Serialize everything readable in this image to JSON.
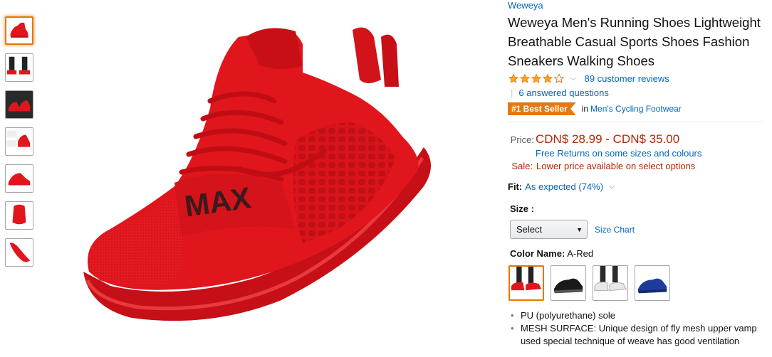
{
  "product": {
    "brand": "Weweya",
    "title": "Weweya Men's Running Shoes Lightweight Breathable Casual Sports Shoes Fashion Sneakers Walking Shoes",
    "rating": 4,
    "rating_max": 5,
    "reviews_text": "89 customer reviews",
    "qa_text": "6 answered questions",
    "best_seller_badge": "#1 Best Seller",
    "best_seller_in": "in",
    "best_seller_category": "Men's Cycling Footwear"
  },
  "pricing": {
    "price_label": "Price:",
    "price_range": "CDN$ 28.99 - CDN$ 35.00",
    "free_returns": "Free Returns on some sizes and colours",
    "sale_label": "Sale:",
    "sale_text": "Lower price available on select options"
  },
  "fit": {
    "label": "Fit:",
    "value": "As expected (74%)"
  },
  "size": {
    "label": "Size :",
    "selected": "Select",
    "size_chart": "Size Chart"
  },
  "color": {
    "label": "Color Name:",
    "selected": "A-Red",
    "swatches": [
      "red",
      "black",
      "white",
      "blue"
    ]
  },
  "features": [
    "PU (polyurethane) sole",
    "MESH SURFACE: Unique design of fly mesh upper vamp used special technique of weave has good ventilation"
  ],
  "main_image": {
    "band_text": "MAX"
  },
  "colors": {
    "link": "#0066c0",
    "price": "#b12704",
    "badge": "#e47911",
    "star": "#ffa41c",
    "selected_border": "#e77600",
    "shoe_red": "#e0161c"
  }
}
